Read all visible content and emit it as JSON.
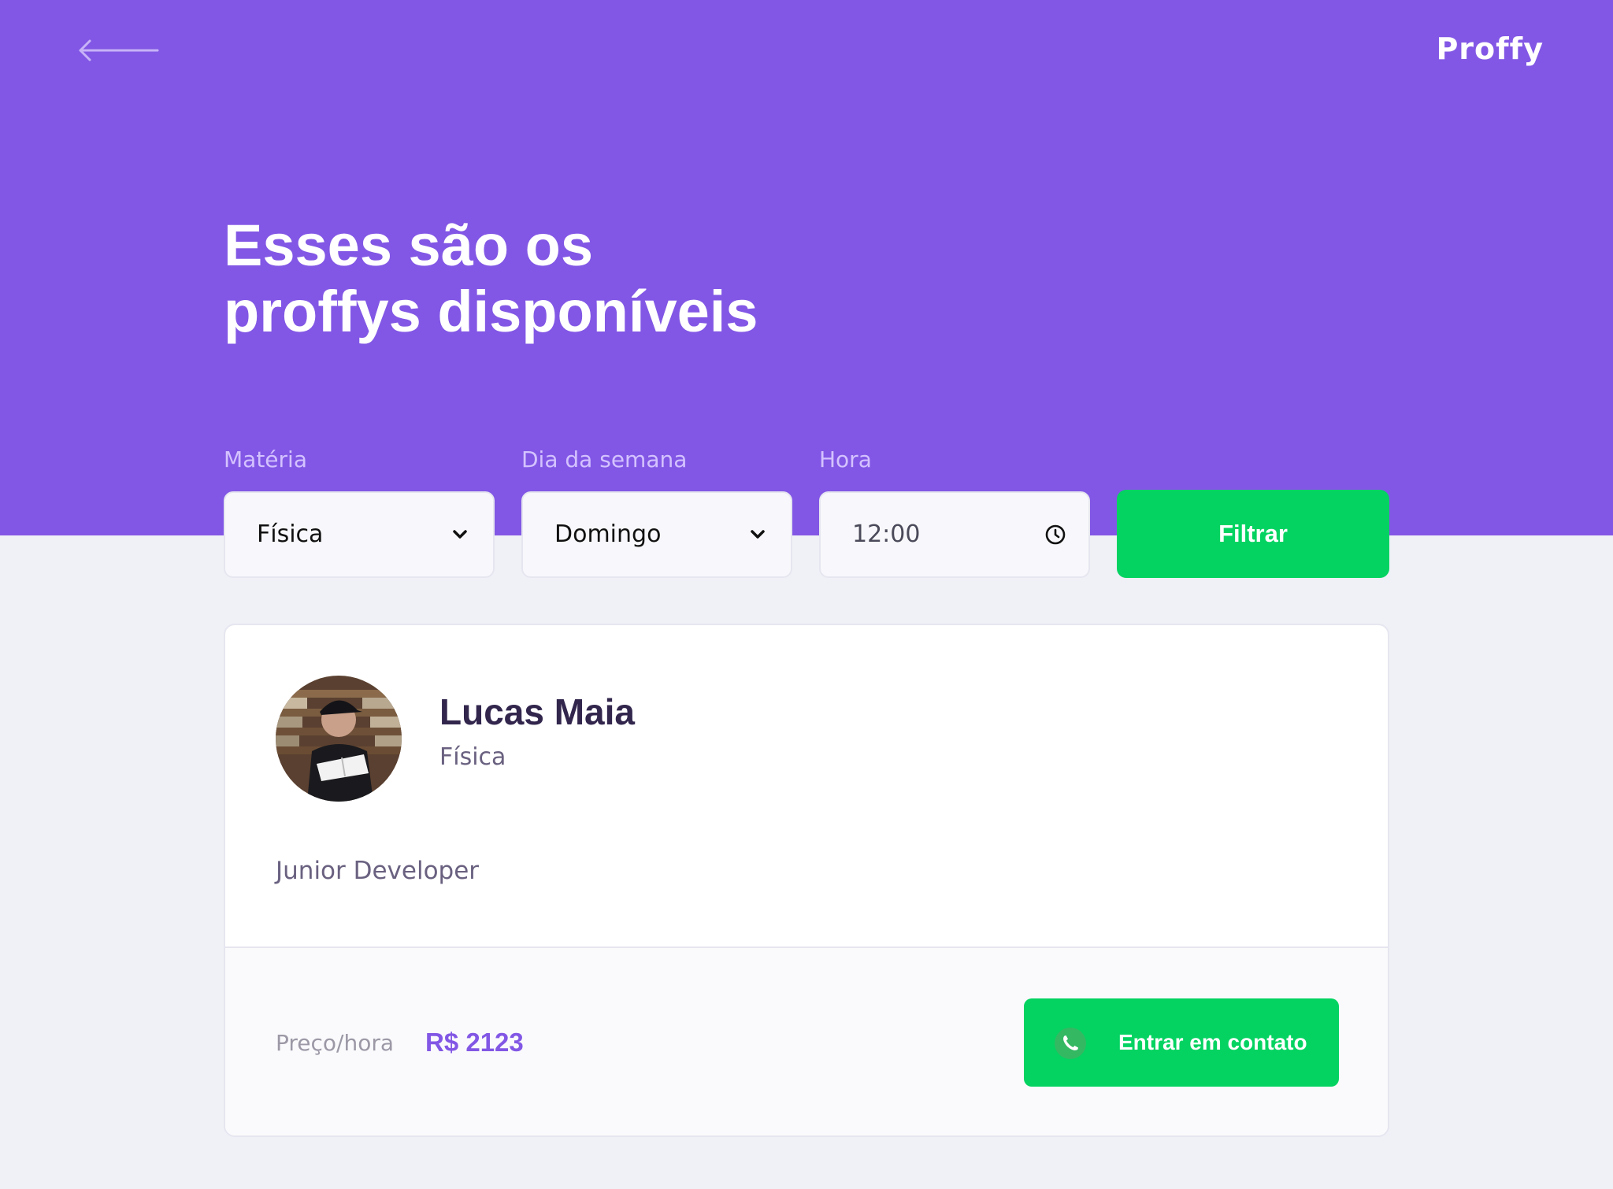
{
  "header": {
    "logo": "Proffy",
    "title_line1": "Esses são os",
    "title_line2": "proffys disponíveis",
    "back_icon": "arrow-left-icon"
  },
  "filters": {
    "subject": {
      "label": "Matéria",
      "value": "Física",
      "icon": "chevron-down-icon"
    },
    "week_day": {
      "label": "Dia da semana",
      "value": "Domingo",
      "icon": "chevron-down-icon"
    },
    "time": {
      "label": "Hora",
      "value": "12:00",
      "icon": "clock-icon"
    },
    "submit_label": "Filtrar"
  },
  "teacher": {
    "name": "Lucas Maia",
    "subject": "Física",
    "bio": "Junior Developer",
    "price_label": "Preço/hora",
    "price": "R$ 2123",
    "contact_label": "Entrar em contato",
    "contact_icon": "whatsapp-icon"
  },
  "colors": {
    "primary": "#8257E5",
    "secondary": "#04D361",
    "background": "#F0F0F7",
    "title_dark": "#32264D",
    "text_muted": "#6A6180"
  }
}
